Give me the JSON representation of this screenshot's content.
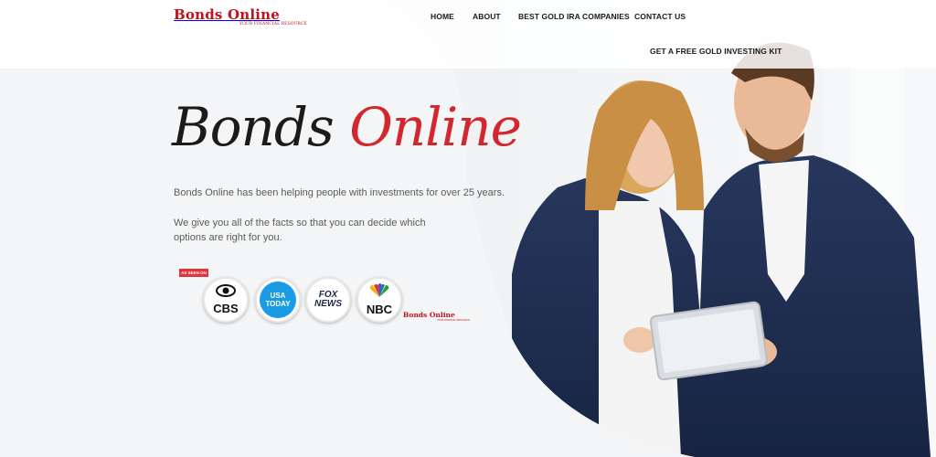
{
  "brand": {
    "name": "Bonds Online",
    "tagline": "YOUR FINANCIAL RESOURCE"
  },
  "nav": {
    "items": [
      {
        "label": "HOME"
      },
      {
        "label": "ABOUT"
      },
      {
        "label": "BEST GOLD IRA COMPANIES"
      },
      {
        "label": "CONTACT US"
      },
      {
        "label": "GET A FREE GOLD INVESTING KIT"
      }
    ]
  },
  "hero": {
    "title_part1": "Bonds",
    "title_part2": "Online",
    "paragraph1": "Bonds Online has been helping people with investments for over 25 years.",
    "paragraph2": "We give you all of the facts so that you can decide which options are right for you.",
    "image": "business-couple-with-tablet-photo"
  },
  "as_seen_on": {
    "label": "AS SEEN ON",
    "logos": [
      {
        "name": "CBS",
        "icon": "cbs-eye-icon"
      },
      {
        "name": "USA TODAY",
        "line1": "USA",
        "line2": "TODAY"
      },
      {
        "name": "FOX NEWS",
        "line1": "FOX",
        "line2": "NEWS"
      },
      {
        "name": "NBC",
        "icon": "nbc-peacock-icon"
      }
    ],
    "brand_mark": "Bonds Online",
    "brand_mark_tag": "YOUR FINANCIAL RESOURCE"
  },
  "colors": {
    "brand_red": "#c1111a",
    "accent_red": "#d4272d",
    "navy_suit": "#1f2f52",
    "usa_today_blue": "#1a9be6"
  }
}
